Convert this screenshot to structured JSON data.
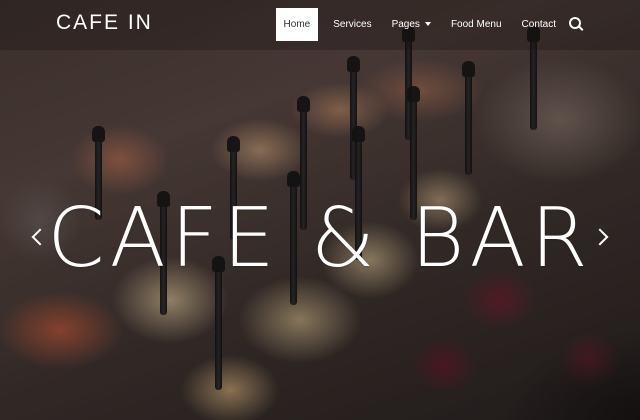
{
  "brand": {
    "name": "CAFE IN"
  },
  "nav": {
    "items": [
      {
        "label": "Home",
        "active": true
      },
      {
        "label": "Services"
      },
      {
        "label": "Pages",
        "dropdown": true
      },
      {
        "label": "Food Menu"
      },
      {
        "label": "Contact"
      }
    ],
    "search_icon": "search-icon"
  },
  "hero": {
    "title": "CAFE & BAR",
    "prev_icon": "chevron-left-icon",
    "next_icon": "chevron-right-icon"
  },
  "colors": {
    "nav_active_bg": "#ffffff",
    "nav_active_text": "#333333",
    "text": "#ffffff"
  }
}
